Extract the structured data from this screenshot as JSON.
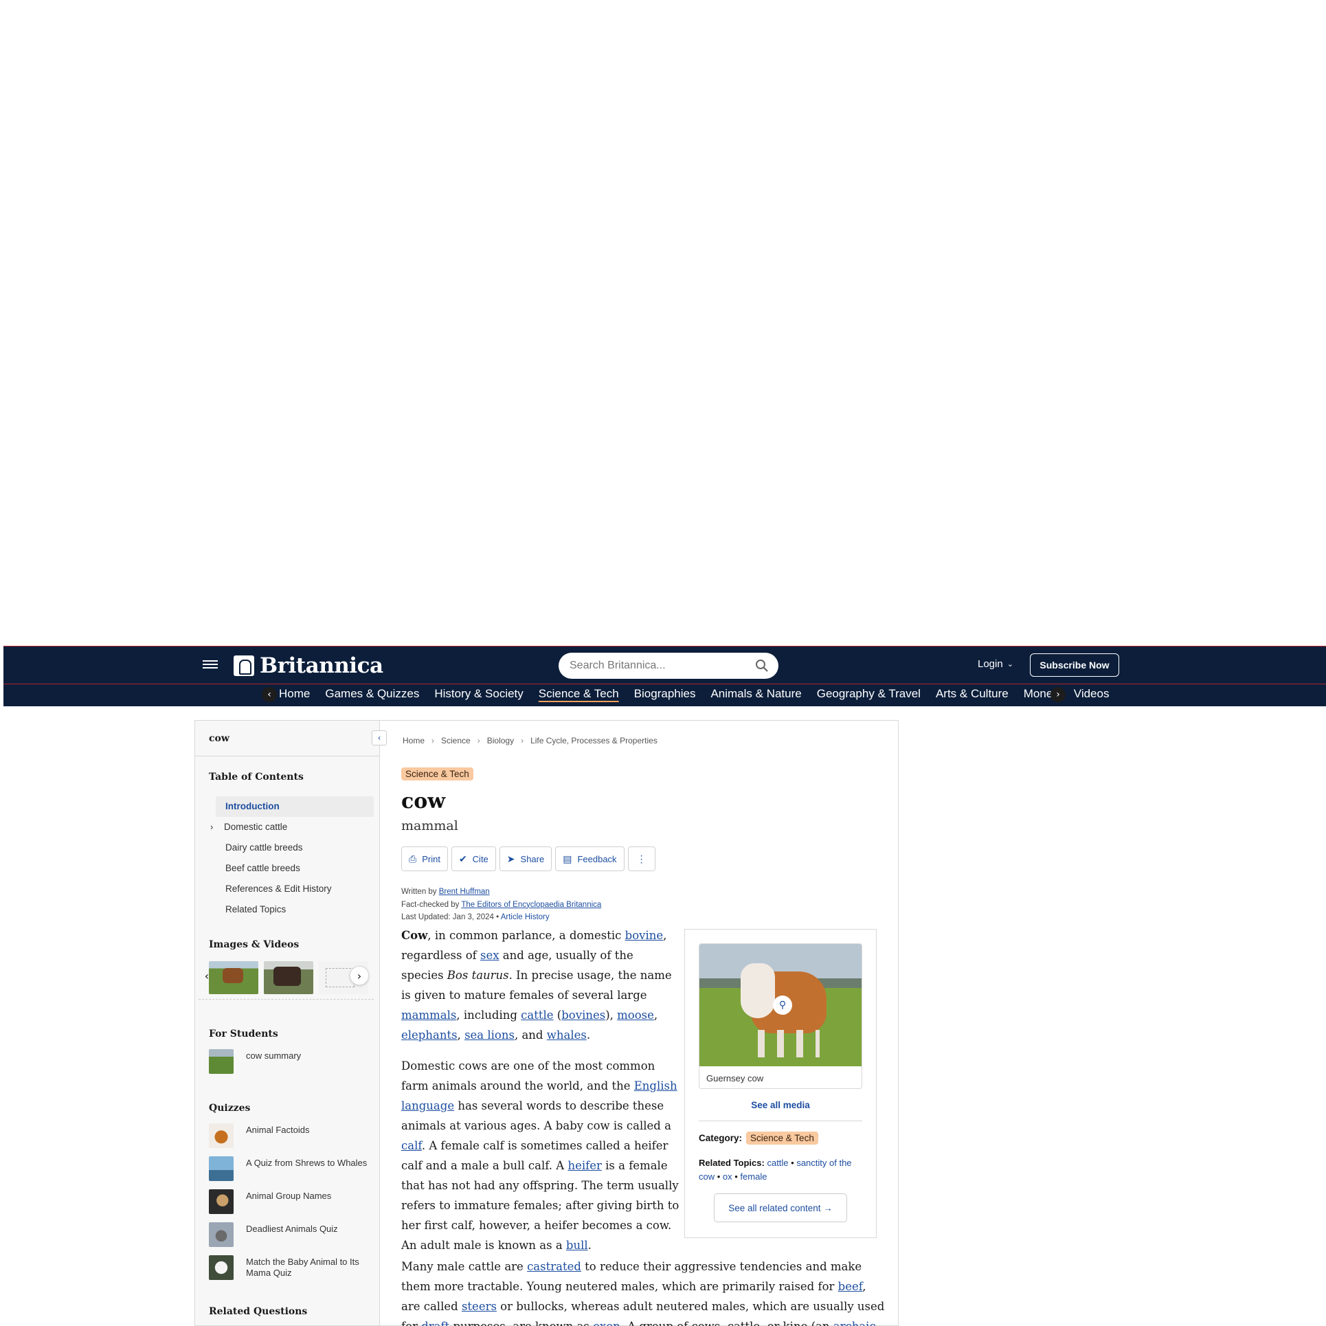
{
  "header": {
    "logo_text": "Britannica",
    "search_placeholder": "Search Britannica...",
    "login_label": "Login",
    "subscribe_label": "Subscribe Now"
  },
  "nav": {
    "items": [
      "Home",
      "Games & Quizzes",
      "History & Society",
      "Science & Tech",
      "Biographies",
      "Animals & Nature",
      "Geography & Travel",
      "Arts & Culture",
      "Money",
      "Videos"
    ],
    "active": "Science & Tech"
  },
  "sidebar": {
    "topic": "cow",
    "toc_title": "Table of Contents",
    "toc": [
      "Introduction",
      "Domestic cattle",
      "Dairy cattle breeds",
      "Beef cattle breeds",
      "References & Edit History",
      "Related Topics"
    ],
    "images_title": "Images & Videos",
    "students_title": "For Students",
    "students": [
      "cow summary"
    ],
    "quizzes_title": "Quizzes",
    "quizzes": [
      "Animal Factoids",
      "A Quiz from Shrews to Whales",
      "Animal Group Names",
      "Deadliest Animals Quiz",
      "Match the Baby Animal to Its Mama Quiz"
    ],
    "related_questions_title": "Related Questions"
  },
  "article": {
    "breadcrumbs": [
      "Home",
      "Science",
      "Biology",
      "Life Cycle, Processes & Properties"
    ],
    "category_pill": "Science & Tech",
    "title": "cow",
    "subtitle": "mammal",
    "actions": [
      "Print",
      "Cite",
      "Share",
      "Feedback"
    ],
    "written_by_label": "Written by",
    "author": "Brent Huffman",
    "fact_checked_label": "Fact-checked by",
    "fact_checker": "The Editors of Encyclopaedia Britannica",
    "last_updated": "Last Updated: Jan 3, 2024",
    "article_history": "Article History"
  },
  "media": {
    "caption": "Guernsey cow",
    "see_all_media": "See all media",
    "category_label": "Category:",
    "category_value": "Science & Tech",
    "related_topics_label": "Related Topics:",
    "related_topics": [
      "cattle",
      "sanctity of the cow",
      "ox",
      "female"
    ],
    "see_all_related": "See all related content →"
  },
  "colors": {
    "header_bg": "#0c1e3a",
    "accent_red": "#b3262b",
    "link": "#1d4ea0",
    "pill": "#f9c9a0"
  }
}
